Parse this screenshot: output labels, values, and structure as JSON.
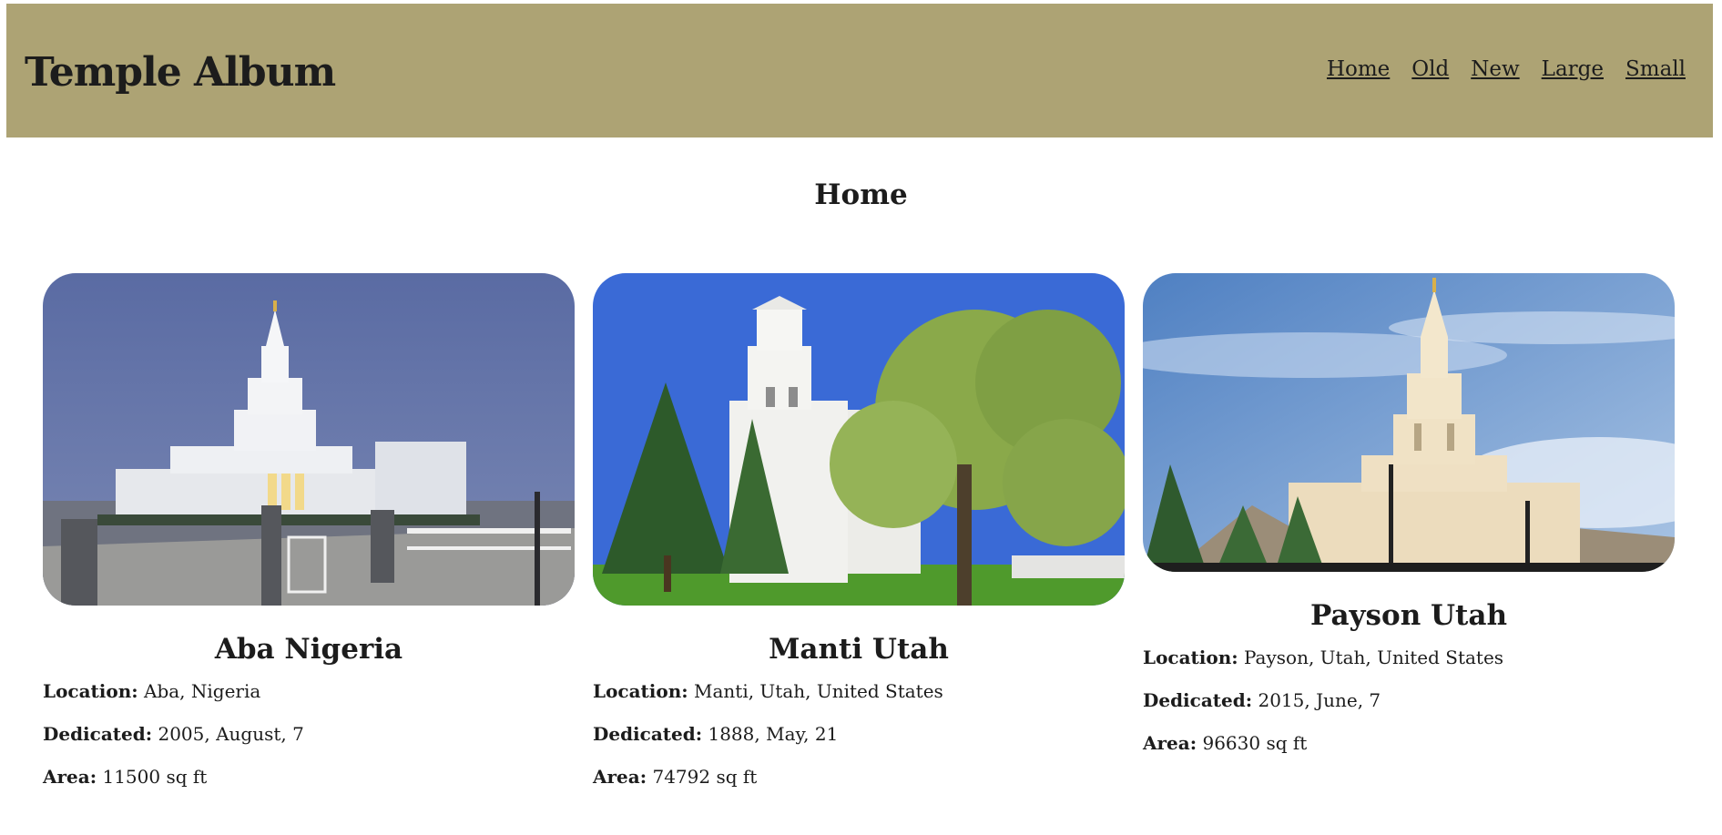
{
  "header": {
    "title": "Temple Album",
    "nav": [
      "Home",
      "Old",
      "New",
      "Large",
      "Small"
    ],
    "background": "#ada374"
  },
  "page": {
    "heading": "Home"
  },
  "labels": {
    "location": "Location:",
    "dedicated": "Dedicated:",
    "area": "Area:"
  },
  "temples": [
    {
      "name": "Aba Nigeria",
      "location": "Aba, Nigeria",
      "dedicated": "2005, August, 7",
      "area": "11500 sq ft"
    },
    {
      "name": "Manti Utah",
      "location": "Manti, Utah, United States",
      "dedicated": "1888, May, 21",
      "area": "74792 sq ft"
    },
    {
      "name": "Payson Utah",
      "location": "Payson, Utah, United States",
      "dedicated": "2015, June, 7",
      "area": "96630 sq ft"
    }
  ]
}
